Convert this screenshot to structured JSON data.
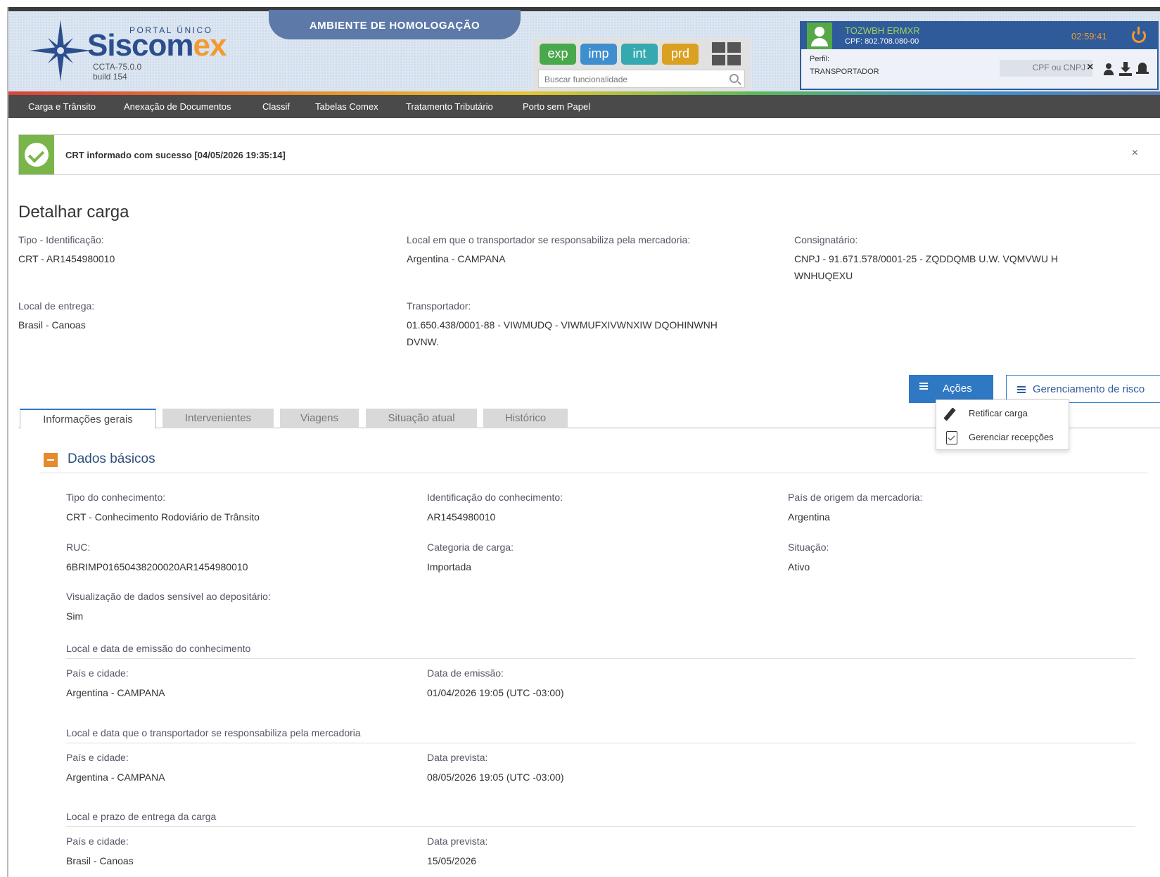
{
  "header": {
    "portal_label": "PORTAL ÚNICO",
    "logo_sis": "Siscom",
    "logo_ex": "ex",
    "version": "CCTA-75.0.0",
    "build": "build 154",
    "environment": "AMBIENTE DE HOMOLOGAÇÃO",
    "env_buttons": [
      "exp",
      "imp",
      "int",
      "prd"
    ],
    "search_placeholder": "Buscar funcionalidade",
    "user_name": "TOZWBH ERMXR",
    "user_cpf": "CPF: 802.708.080-00",
    "timer": "02:59:41",
    "perfil_label": "Perfil:",
    "perfil_value": "TRANSPORTADOR",
    "cpf_cnpj_placeholder": "CPF ou CNPJ"
  },
  "nav": [
    "Carga e Trânsito",
    "Anexação de Documentos",
    "Classif",
    "Tabelas Comex",
    "Tratamento Tributário",
    "Porto sem Papel"
  ],
  "alert": {
    "message": "CRT informado com sucesso [04/05/2026 19:35:14]",
    "close": "×"
  },
  "page": {
    "title": "Detalhar carga",
    "tipo_label": "Tipo - Identificação:",
    "tipo_value": "CRT - AR1454980010",
    "local_resp_label": "Local em que o transportador se responsabiliza pela mercadoria:",
    "local_resp_value": "Argentina - CAMPANA",
    "consignatario_label": "Consignatário:",
    "consignatario_value_1": "CNPJ - 91.671.578/0001-25 - ZQDDQMB U.W. VQMVWU H",
    "consignatario_value_2": "WNHUQEXU",
    "local_entrega_label": "Local de entrega:",
    "local_entrega_value": "Brasil - Canoas",
    "transportador_label": "Transportador:",
    "transportador_value_1": "01.650.438/0001-88 - VIWMUDQ - VIWMUFXIVWNXIW DQOHINWNH",
    "transportador_value_2": "DVNW."
  },
  "actions": {
    "acoes": "Ações",
    "gerenciamento": "Gerenciamento de risco",
    "dropdown": [
      "Retificar carga",
      "Gerenciar recepções"
    ]
  },
  "tabs": [
    "Informações gerais",
    "Intervenientes",
    "Viagens",
    "Situação atual",
    "Histórico"
  ],
  "dados": {
    "section_title": "Dados básicos",
    "tipo_conhecimento_label": "Tipo do conhecimento:",
    "tipo_conhecimento_value": "CRT - Conhecimento Rodoviário de Trânsito",
    "id_conhecimento_label": "Identificação do conhecimento:",
    "id_conhecimento_value": "AR1454980010",
    "pais_origem_label": "País de origem da mercadoria:",
    "pais_origem_value": "Argentina",
    "ruc_label": "RUC:",
    "ruc_value": "6BRIMP01650438200020AR1454980010",
    "categoria_label": "Categoria de carga:",
    "categoria_value": "Importada",
    "situacao_label": "Situação:",
    "situacao_value": "Ativo",
    "visualizacao_label": "Visualização de dados sensível ao depositário:",
    "visualizacao_value": "Sim",
    "emissao_heading": "Local e data de emissão do conhecimento",
    "emissao_pais_label": "País e cidade:",
    "emissao_pais_value": "Argentina - CAMPANA",
    "emissao_data_label": "Data de emissão:",
    "emissao_data_value": "01/04/2026 19:05 (UTC -03:00)",
    "resp_heading": "Local e data que o transportador se responsabiliza pela mercadoria",
    "resp_pais_label": "País e cidade:",
    "resp_pais_value": "Argentina - CAMPANA",
    "resp_data_label": "Data prevista:",
    "resp_data_value": "08/05/2026 19:05 (UTC -03:00)",
    "entrega_heading": "Local e prazo de entrega da carga",
    "entrega_pais_label": "País e cidade:",
    "entrega_pais_value": "Brasil - Canoas",
    "entrega_data_label": "Data prevista:",
    "entrega_data_value": "15/05/2026"
  }
}
